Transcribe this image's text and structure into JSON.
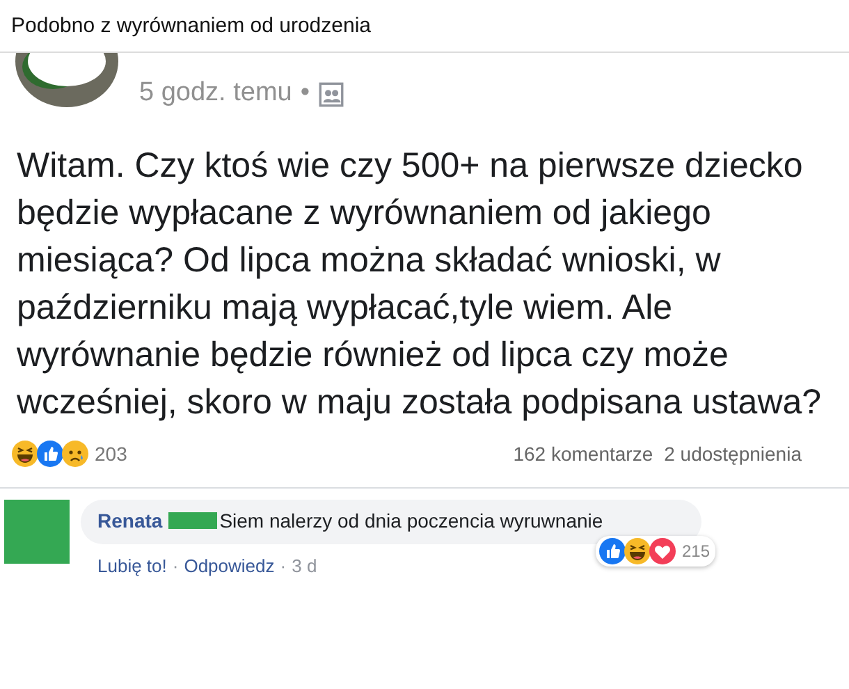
{
  "caption": "Podobno z wyrównaniem od urodzenia",
  "post": {
    "time": "5 godz. temu",
    "separator": "•",
    "text": "Witam. Czy ktoś wie czy 500+ na pierwsze dziecko będzie wypłacane z wyrównaniem od jakiego miesiąca? Od lipca można składać wnioski, w październiku mają wypłacać,tyle wiem. Ale wyrównanie będzie również od lipca czy może wcześniej, skoro w maju została podpisana ustawa?",
    "reactions": [
      {
        "kind": "haha"
      },
      {
        "kind": "like"
      },
      {
        "kind": "sad"
      }
    ],
    "reaction_count": "203",
    "comments": "162 komentarze",
    "shares": "2 udostępnienia"
  },
  "comment": {
    "author": "Renata",
    "text": "Siem nalerzy od dnia poczencia wyruwnanie",
    "reactions": [
      {
        "kind": "like"
      },
      {
        "kind": "haha"
      },
      {
        "kind": "love"
      }
    ],
    "reaction_count": "215",
    "actions": [
      "Lubię to!",
      "Odpowiedz"
    ],
    "action_separator": "·",
    "time": "3 d"
  }
}
